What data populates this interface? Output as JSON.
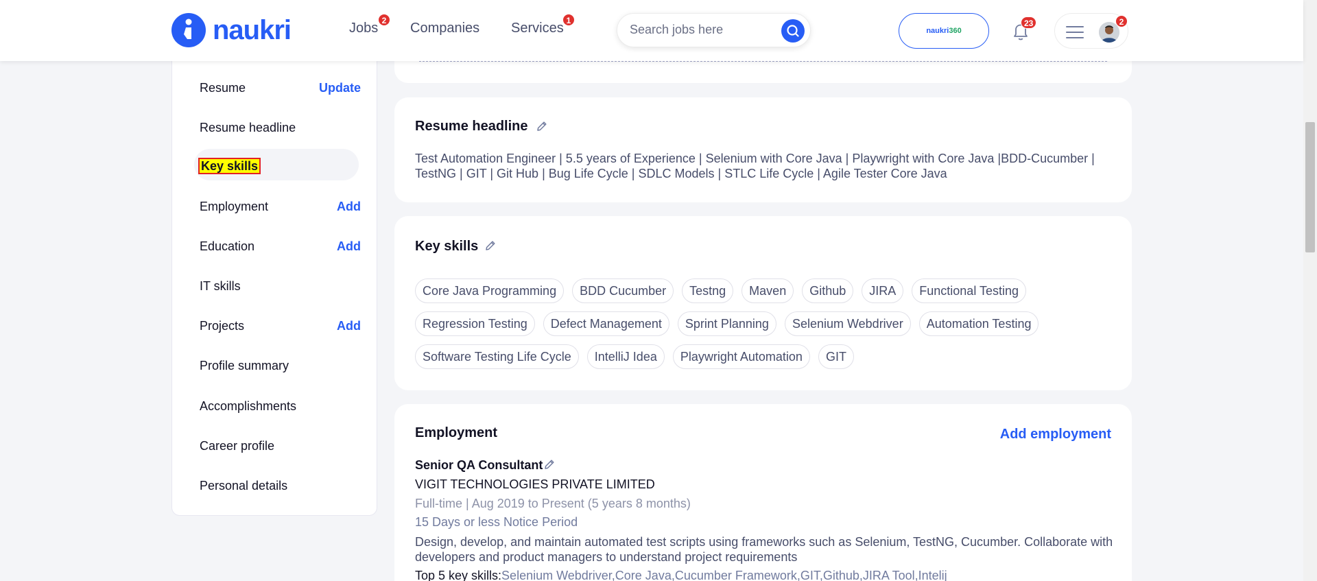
{
  "header": {
    "logo_text": "naukri",
    "nav": [
      {
        "label": "Jobs",
        "badge": "2"
      },
      {
        "label": "Companies"
      },
      {
        "label": "Services",
        "badge": "1"
      }
    ],
    "search_placeholder": "Search jobs here",
    "naukri360_prefix": "naukri",
    "naukri360_suffix": "360",
    "notifications_badge": "23",
    "menu_badge": "2"
  },
  "sidebar": {
    "items": [
      {
        "label": "Resume",
        "action": "Update"
      },
      {
        "label": "Resume headline",
        "action": ""
      },
      {
        "label": "Key skills",
        "action": ""
      },
      {
        "label": "Employment",
        "action": "Add"
      },
      {
        "label": "Education",
        "action": "Add"
      },
      {
        "label": "IT skills",
        "action": ""
      },
      {
        "label": "Projects",
        "action": "Add"
      },
      {
        "label": "Profile summary",
        "action": ""
      },
      {
        "label": "Accomplishments",
        "action": ""
      },
      {
        "label": "Career profile",
        "action": ""
      },
      {
        "label": "Personal details",
        "action": ""
      }
    ]
  },
  "resume_headline": {
    "title": "Resume headline",
    "line1": "Test Automation Engineer | 5.5 years of Experience | Selenium with Core Java | Playwright with Core Java |BDD-Cucumber |",
    "line2": "TestNG | GIT | Git Hub | Bug Life Cycle | SDLC Models | STLC Life Cycle | Agile Tester Core Java"
  },
  "key_skills": {
    "title": "Key skills",
    "rows": [
      [
        "Core Java Programming",
        "BDD Cucumber",
        "Testng",
        "Maven",
        "Github",
        "JIRA",
        "Functional Testing"
      ],
      [
        "Regression Testing",
        "Defect Management",
        "Sprint Planning",
        "Selenium Webdriver",
        "Automation Testing"
      ],
      [
        "Software Testing Life Cycle",
        "IntelliJ Idea",
        "Playwright Automation",
        "GIT"
      ]
    ]
  },
  "employment": {
    "title": "Employment",
    "add_label": "Add employment",
    "designation": "Senior QA Consultant",
    "company": "VIGIT TECHNOLOGIES PRIVATE LIMITED",
    "duration": "Full-time | Aug 2019 to Present (5 years 8 months)",
    "notice": "15 Days or less Notice Period",
    "desc1": "Design, develop, and maintain automated test scripts using frameworks such as Selenium, TestNG, Cucumber. Collaborate with",
    "desc2": "developers and product managers to understand project requirements",
    "top_skills_label": "Top 5 key skills:",
    "top_skills": "Selenium Webdriver,Core Java,Cucumber Framework,GIT,Github,JIRA Tool,Intelij"
  },
  "colors": {
    "brand": "#275df5",
    "badge": "#e0312e",
    "highlight": "#ffff00"
  }
}
